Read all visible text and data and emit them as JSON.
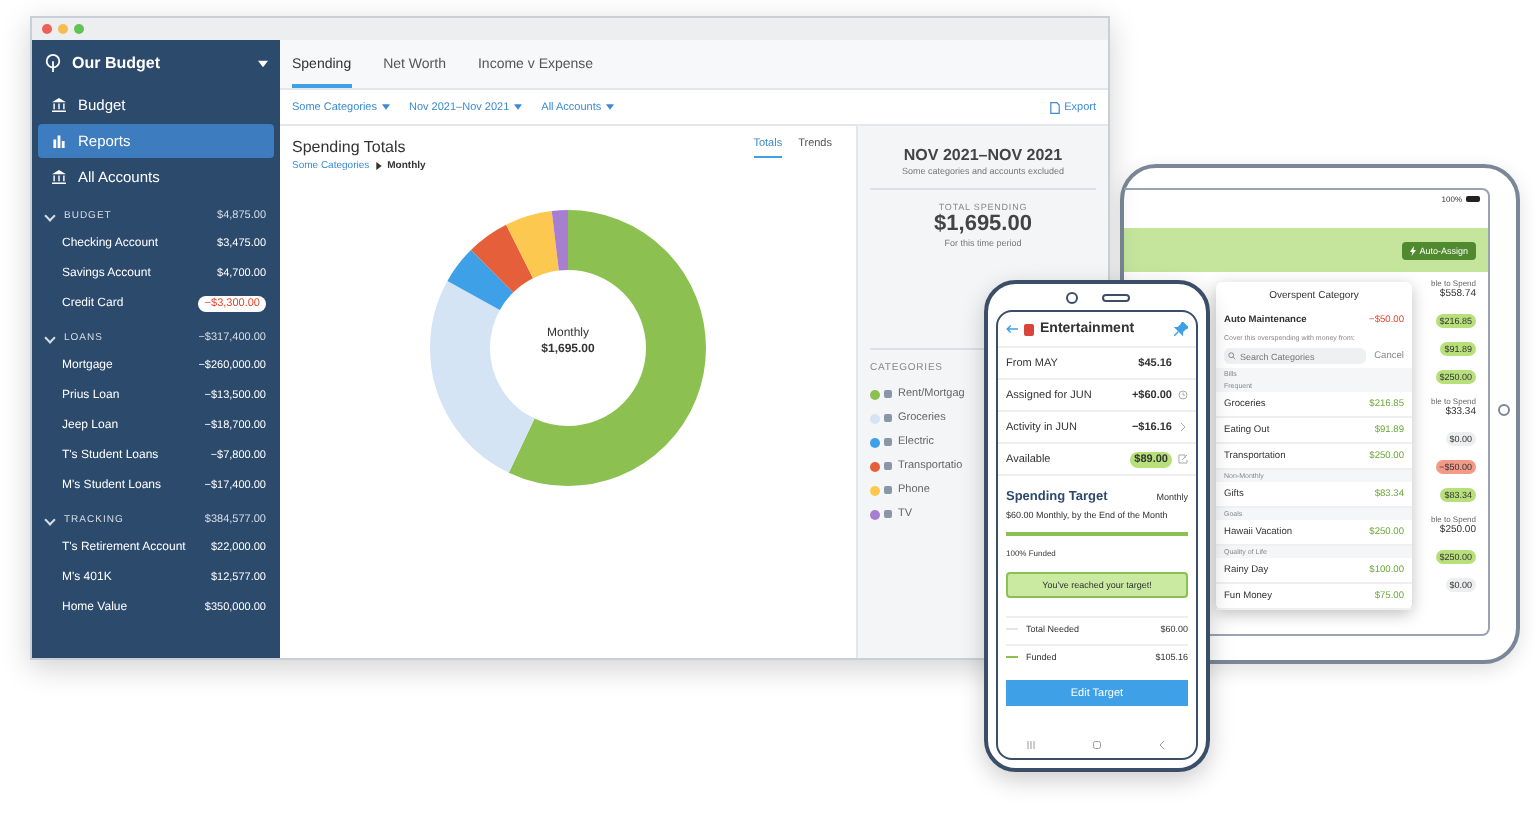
{
  "desktop": {
    "sidebar": {
      "title": "Our Budget",
      "nav": [
        {
          "label": "Budget",
          "selected": false
        },
        {
          "label": "Reports",
          "selected": true
        },
        {
          "label": "All Accounts",
          "selected": false
        }
      ],
      "groups": [
        {
          "name": "BUDGET",
          "total": "$4,875.00",
          "accounts": [
            {
              "name": "Checking Account",
              "balance": "$3,475.00",
              "flagged": false
            },
            {
              "name": "Savings Account",
              "balance": "$4,700.00",
              "flagged": false
            },
            {
              "name": "Credit Card",
              "balance": "−$3,300.00",
              "flagged": true
            }
          ]
        },
        {
          "name": "LOANS",
          "total": "−$317,400.00",
          "accounts": [
            {
              "name": "Mortgage",
              "balance": "−$260,000.00",
              "flagged": false
            },
            {
              "name": "Prius Loan",
              "balance": "−$13,500.00",
              "flagged": false
            },
            {
              "name": "Jeep Loan",
              "balance": "−$18,700.00",
              "flagged": false
            },
            {
              "name": "T's Student Loans",
              "balance": "−$7,800.00",
              "flagged": false
            },
            {
              "name": "M's Student Loans",
              "balance": "−$17,400.00",
              "flagged": false
            }
          ]
        },
        {
          "name": "TRACKING",
          "total": "$384,577.00",
          "accounts": [
            {
              "name": "T's Retirement Account",
              "balance": "$22,000.00",
              "flagged": false
            },
            {
              "name": "M's 401K",
              "balance": "$12,577.00",
              "flagged": false
            },
            {
              "name": "Home Value",
              "balance": "$350,000.00",
              "flagged": false
            }
          ]
        }
      ]
    },
    "tabs": [
      {
        "label": "Spending",
        "selected": true
      },
      {
        "label": "Net Worth",
        "selected": false
      },
      {
        "label": "Income v Expense",
        "selected": false
      }
    ],
    "filters": [
      "Some Categories",
      "Nov 2021–Nov 2021",
      "All Accounts"
    ],
    "export": "Export",
    "chart": {
      "title": "Spending Totals",
      "breadcrumb": [
        "Some Categories",
        "Monthly"
      ],
      "views": [
        {
          "label": "Totals",
          "selected": true
        },
        {
          "label": "Trends",
          "selected": false
        }
      ],
      "center_label": "Monthly",
      "center_value": "$1,695.00"
    },
    "summary": {
      "range": "NOV 2021–NOV 2021",
      "note": "Some categories and accounts excluded",
      "total_label": "TOTAL SPENDING",
      "total": "$1,695.00",
      "total_note": "For this time period",
      "categories_heading": "CATEGORIES",
      "categories": [
        {
          "name": "Rent/Mortgag",
          "color": "#8cc152"
        },
        {
          "name": "Groceries",
          "color": "#d4e4f4"
        },
        {
          "name": "Electric",
          "color": "#3ea0e6"
        },
        {
          "name": "Transportatio",
          "color": "#e5603a"
        },
        {
          "name": "Phone",
          "color": "#fcc850"
        },
        {
          "name": "TV",
          "color": "#a87fd0"
        }
      ]
    }
  },
  "phone": {
    "title": "Entertainment",
    "rows": [
      {
        "label": "From MAY",
        "value": "$45.16",
        "kind": "plain"
      },
      {
        "label": "Assigned for JUN",
        "value": "+$60.00",
        "kind": "clock"
      },
      {
        "label": "Activity in JUN",
        "value": "−$16.16",
        "kind": "chevron"
      },
      {
        "label": "Available",
        "value": "$89.00",
        "kind": "pill"
      }
    ],
    "target_title": "Spending Target",
    "target_period": "Monthly",
    "target_desc": "$60.00 Monthly, by the End of the Month",
    "level": 1.0,
    "funded_label": "100% Funded",
    "message": "You've reached your target!",
    "legend": [
      {
        "label": "Total Needed",
        "value": "$60.00",
        "color": "#e3e6ea"
      },
      {
        "label": "Funded",
        "value": "$105.16",
        "color": "#8cc152"
      }
    ],
    "button": "Edit Target"
  },
  "tablet": {
    "battery": "100%",
    "assign_button": "Auto-Assign",
    "column": [
      {
        "kind": "header",
        "label": "ble to Spend",
        "value": "$558.74"
      },
      {
        "kind": "pill",
        "value": "$216.85",
        "color": "#b7e07a"
      },
      {
        "kind": "pill",
        "value": "$91.89",
        "color": "#b7e07a"
      },
      {
        "kind": "pill",
        "value": "$250.00",
        "color": "#b7e07a"
      },
      {
        "kind": "header",
        "label": "ble to Spend",
        "value": "$33.34"
      },
      {
        "kind": "pill",
        "value": "$0.00",
        "color": "#eceef0"
      },
      {
        "kind": "pill",
        "value": "−$50.00",
        "color": "#f29a88"
      },
      {
        "kind": "pill",
        "value": "$83.34",
        "color": "#b7e07a"
      },
      {
        "kind": "header",
        "label": "ble to Spend",
        "value": "$250.00"
      },
      {
        "kind": "pill",
        "value": "$250.00",
        "color": "#b7e07a"
      },
      {
        "kind": "pill",
        "value": "$0.00",
        "color": "#eceef0"
      }
    ],
    "popup": {
      "title": "Overspent Category",
      "category": "Auto Maintenance",
      "amount": "−$50.00",
      "hint": "Cover this overspending with money from:",
      "search_placeholder": "Search Categories",
      "cancel": "Cancel",
      "sections": [
        {
          "name": "Bills"
        },
        {
          "name": "Frequent",
          "items": [
            {
              "name": "Groceries",
              "value": "$216.85"
            },
            {
              "name": "Eating Out",
              "value": "$91.89"
            },
            {
              "name": "Transportation",
              "value": "$250.00"
            }
          ]
        },
        {
          "name": "Non-Monthly",
          "items": [
            {
              "name": "Gifts",
              "value": "$83.34"
            }
          ]
        },
        {
          "name": "Goals",
          "items": [
            {
              "name": "Hawaii Vacation",
              "value": "$250.00"
            }
          ]
        },
        {
          "name": "Quality of Life",
          "items": [
            {
              "name": "Rainy Day",
              "value": "$100.00"
            },
            {
              "name": "Fun Money",
              "value": "$75.00"
            }
          ]
        }
      ]
    }
  }
}
